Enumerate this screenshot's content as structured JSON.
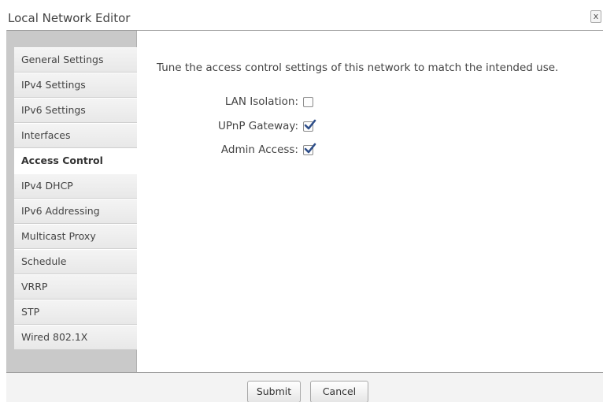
{
  "window": {
    "title": "Local Network Editor",
    "close_label": "x"
  },
  "sidebar": {
    "items": [
      {
        "label": "General Settings",
        "active": false
      },
      {
        "label": "IPv4 Settings",
        "active": false
      },
      {
        "label": "IPv6 Settings",
        "active": false
      },
      {
        "label": "Interfaces",
        "active": false
      },
      {
        "label": "Access Control",
        "active": true
      },
      {
        "label": "IPv4 DHCP",
        "active": false
      },
      {
        "label": "IPv6 Addressing",
        "active": false
      },
      {
        "label": "Multicast Proxy",
        "active": false
      },
      {
        "label": "Schedule",
        "active": false
      },
      {
        "label": "VRRP",
        "active": false
      },
      {
        "label": "STP",
        "active": false
      },
      {
        "label": "Wired 802.1X",
        "active": false
      }
    ]
  },
  "access_control": {
    "description": "Tune the access control settings of this network to match the intended use.",
    "lan_isolation": {
      "label": "LAN Isolation:",
      "checked": false
    },
    "upnp_gateway": {
      "label": "UPnP Gateway:",
      "checked": true
    },
    "admin_access": {
      "label": "Admin Access:",
      "checked": true
    }
  },
  "footer": {
    "submit_label": "Submit",
    "cancel_label": "Cancel"
  },
  "colors": {
    "sidebar_bg": "#c9c9c9",
    "checkmark": "#2f4f8a"
  }
}
